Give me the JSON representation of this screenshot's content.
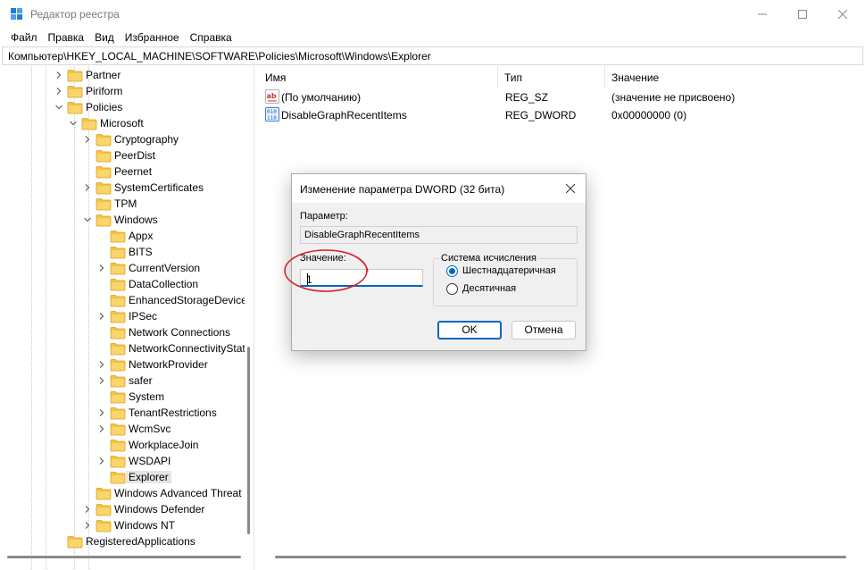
{
  "window": {
    "title": "Редактор реестра"
  },
  "menu": [
    "Файл",
    "Правка",
    "Вид",
    "Избранное",
    "Справка"
  ],
  "address": "Компьютер\\HKEY_LOCAL_MACHINE\\SOFTWARE\\Policies\\Microsoft\\Windows\\Explorer",
  "tree": [
    {
      "label": "Partner",
      "level": 0,
      "expander": "collapsed"
    },
    {
      "label": "Piriform",
      "level": 0,
      "expander": "collapsed"
    },
    {
      "label": "Policies",
      "level": 0,
      "expander": "expanded"
    },
    {
      "label": "Microsoft",
      "level": 1,
      "expander": "expanded"
    },
    {
      "label": "Cryptography",
      "level": 2,
      "expander": "collapsed"
    },
    {
      "label": "PeerDist",
      "level": 2,
      "expander": "none"
    },
    {
      "label": "Peernet",
      "level": 2,
      "expander": "none"
    },
    {
      "label": "SystemCertificates",
      "level": 2,
      "expander": "collapsed"
    },
    {
      "label": "TPM",
      "level": 2,
      "expander": "none"
    },
    {
      "label": "Windows",
      "level": 2,
      "expander": "expanded"
    },
    {
      "label": "Appx",
      "level": 3,
      "expander": "none"
    },
    {
      "label": "BITS",
      "level": 3,
      "expander": "none"
    },
    {
      "label": "CurrentVersion",
      "level": 3,
      "expander": "collapsed"
    },
    {
      "label": "DataCollection",
      "level": 3,
      "expander": "none"
    },
    {
      "label": "EnhancedStorageDevices",
      "level": 3,
      "expander": "none"
    },
    {
      "label": "IPSec",
      "level": 3,
      "expander": "collapsed"
    },
    {
      "label": "Network Connections",
      "level": 3,
      "expander": "none"
    },
    {
      "label": "NetworkConnectivityStatusIndicator",
      "level": 3,
      "expander": "none"
    },
    {
      "label": "NetworkProvider",
      "level": 3,
      "expander": "collapsed"
    },
    {
      "label": "safer",
      "level": 3,
      "expander": "collapsed"
    },
    {
      "label": "System",
      "level": 3,
      "expander": "none"
    },
    {
      "label": "TenantRestrictions",
      "level": 3,
      "expander": "collapsed"
    },
    {
      "label": "WcmSvc",
      "level": 3,
      "expander": "collapsed"
    },
    {
      "label": "WorkplaceJoin",
      "level": 3,
      "expander": "none"
    },
    {
      "label": "WSDAPI",
      "level": 3,
      "expander": "collapsed"
    },
    {
      "label": "Explorer",
      "level": 3,
      "expander": "none",
      "selected": true
    },
    {
      "label": "Windows Advanced Threat Protection",
      "level": 2,
      "expander": "none"
    },
    {
      "label": "Windows Defender",
      "level": 2,
      "expander": "collapsed"
    },
    {
      "label": "Windows NT",
      "level": 2,
      "expander": "collapsed"
    },
    {
      "label": "RegisteredApplications",
      "level": 0,
      "expander": "none"
    }
  ],
  "list": {
    "columns": [
      "Имя",
      "Тип",
      "Значение"
    ],
    "rows": [
      {
        "icon": "string-value-icon",
        "name": "(По умолчанию)",
        "type": "REG_SZ",
        "data": "(значение не присвоено)"
      },
      {
        "icon": "binary-value-icon",
        "name": "DisableGraphRecentItems",
        "type": "REG_DWORD",
        "data": "0x00000000 (0)"
      }
    ]
  },
  "dialog": {
    "title": "Изменение параметра DWORD (32 бита)",
    "name_label": "Параметр:",
    "name_value": "DisableGraphRecentItems",
    "value_label": "Значение:",
    "value": "1",
    "radix_legend": "Система исчисления",
    "radix_options": [
      {
        "label": "Шестнадцатеричная",
        "checked": true
      },
      {
        "label": "Десятичная",
        "checked": false
      }
    ],
    "ok_label": "OK",
    "cancel_label": "Отмена"
  },
  "colors": {
    "accent": "#0067c0",
    "folder": "#f5c242",
    "annotation": "#d9202a"
  }
}
